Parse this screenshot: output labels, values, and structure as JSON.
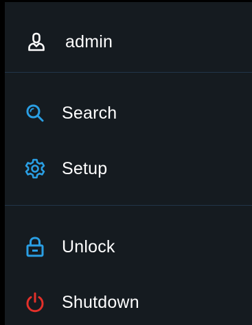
{
  "user": {
    "name": "admin",
    "icon": "user-icon",
    "icon_color": "#ffffff"
  },
  "menu": {
    "items": [
      {
        "label": "Search",
        "icon": "search-icon",
        "icon_color": "#2a9fe4"
      },
      {
        "label": "Setup",
        "icon": "gear-icon",
        "icon_color": "#2a9fe4"
      },
      {
        "label": "Unlock",
        "icon": "unlock-icon",
        "icon_color": "#2a9fe4"
      },
      {
        "label": "Shutdown",
        "icon": "power-icon",
        "icon_color": "#e3302a"
      }
    ]
  },
  "colors": {
    "background": "#151b20",
    "divider": "#22354a",
    "text": "#ffffff",
    "accent": "#2a9fe4",
    "danger": "#e3302a"
  }
}
